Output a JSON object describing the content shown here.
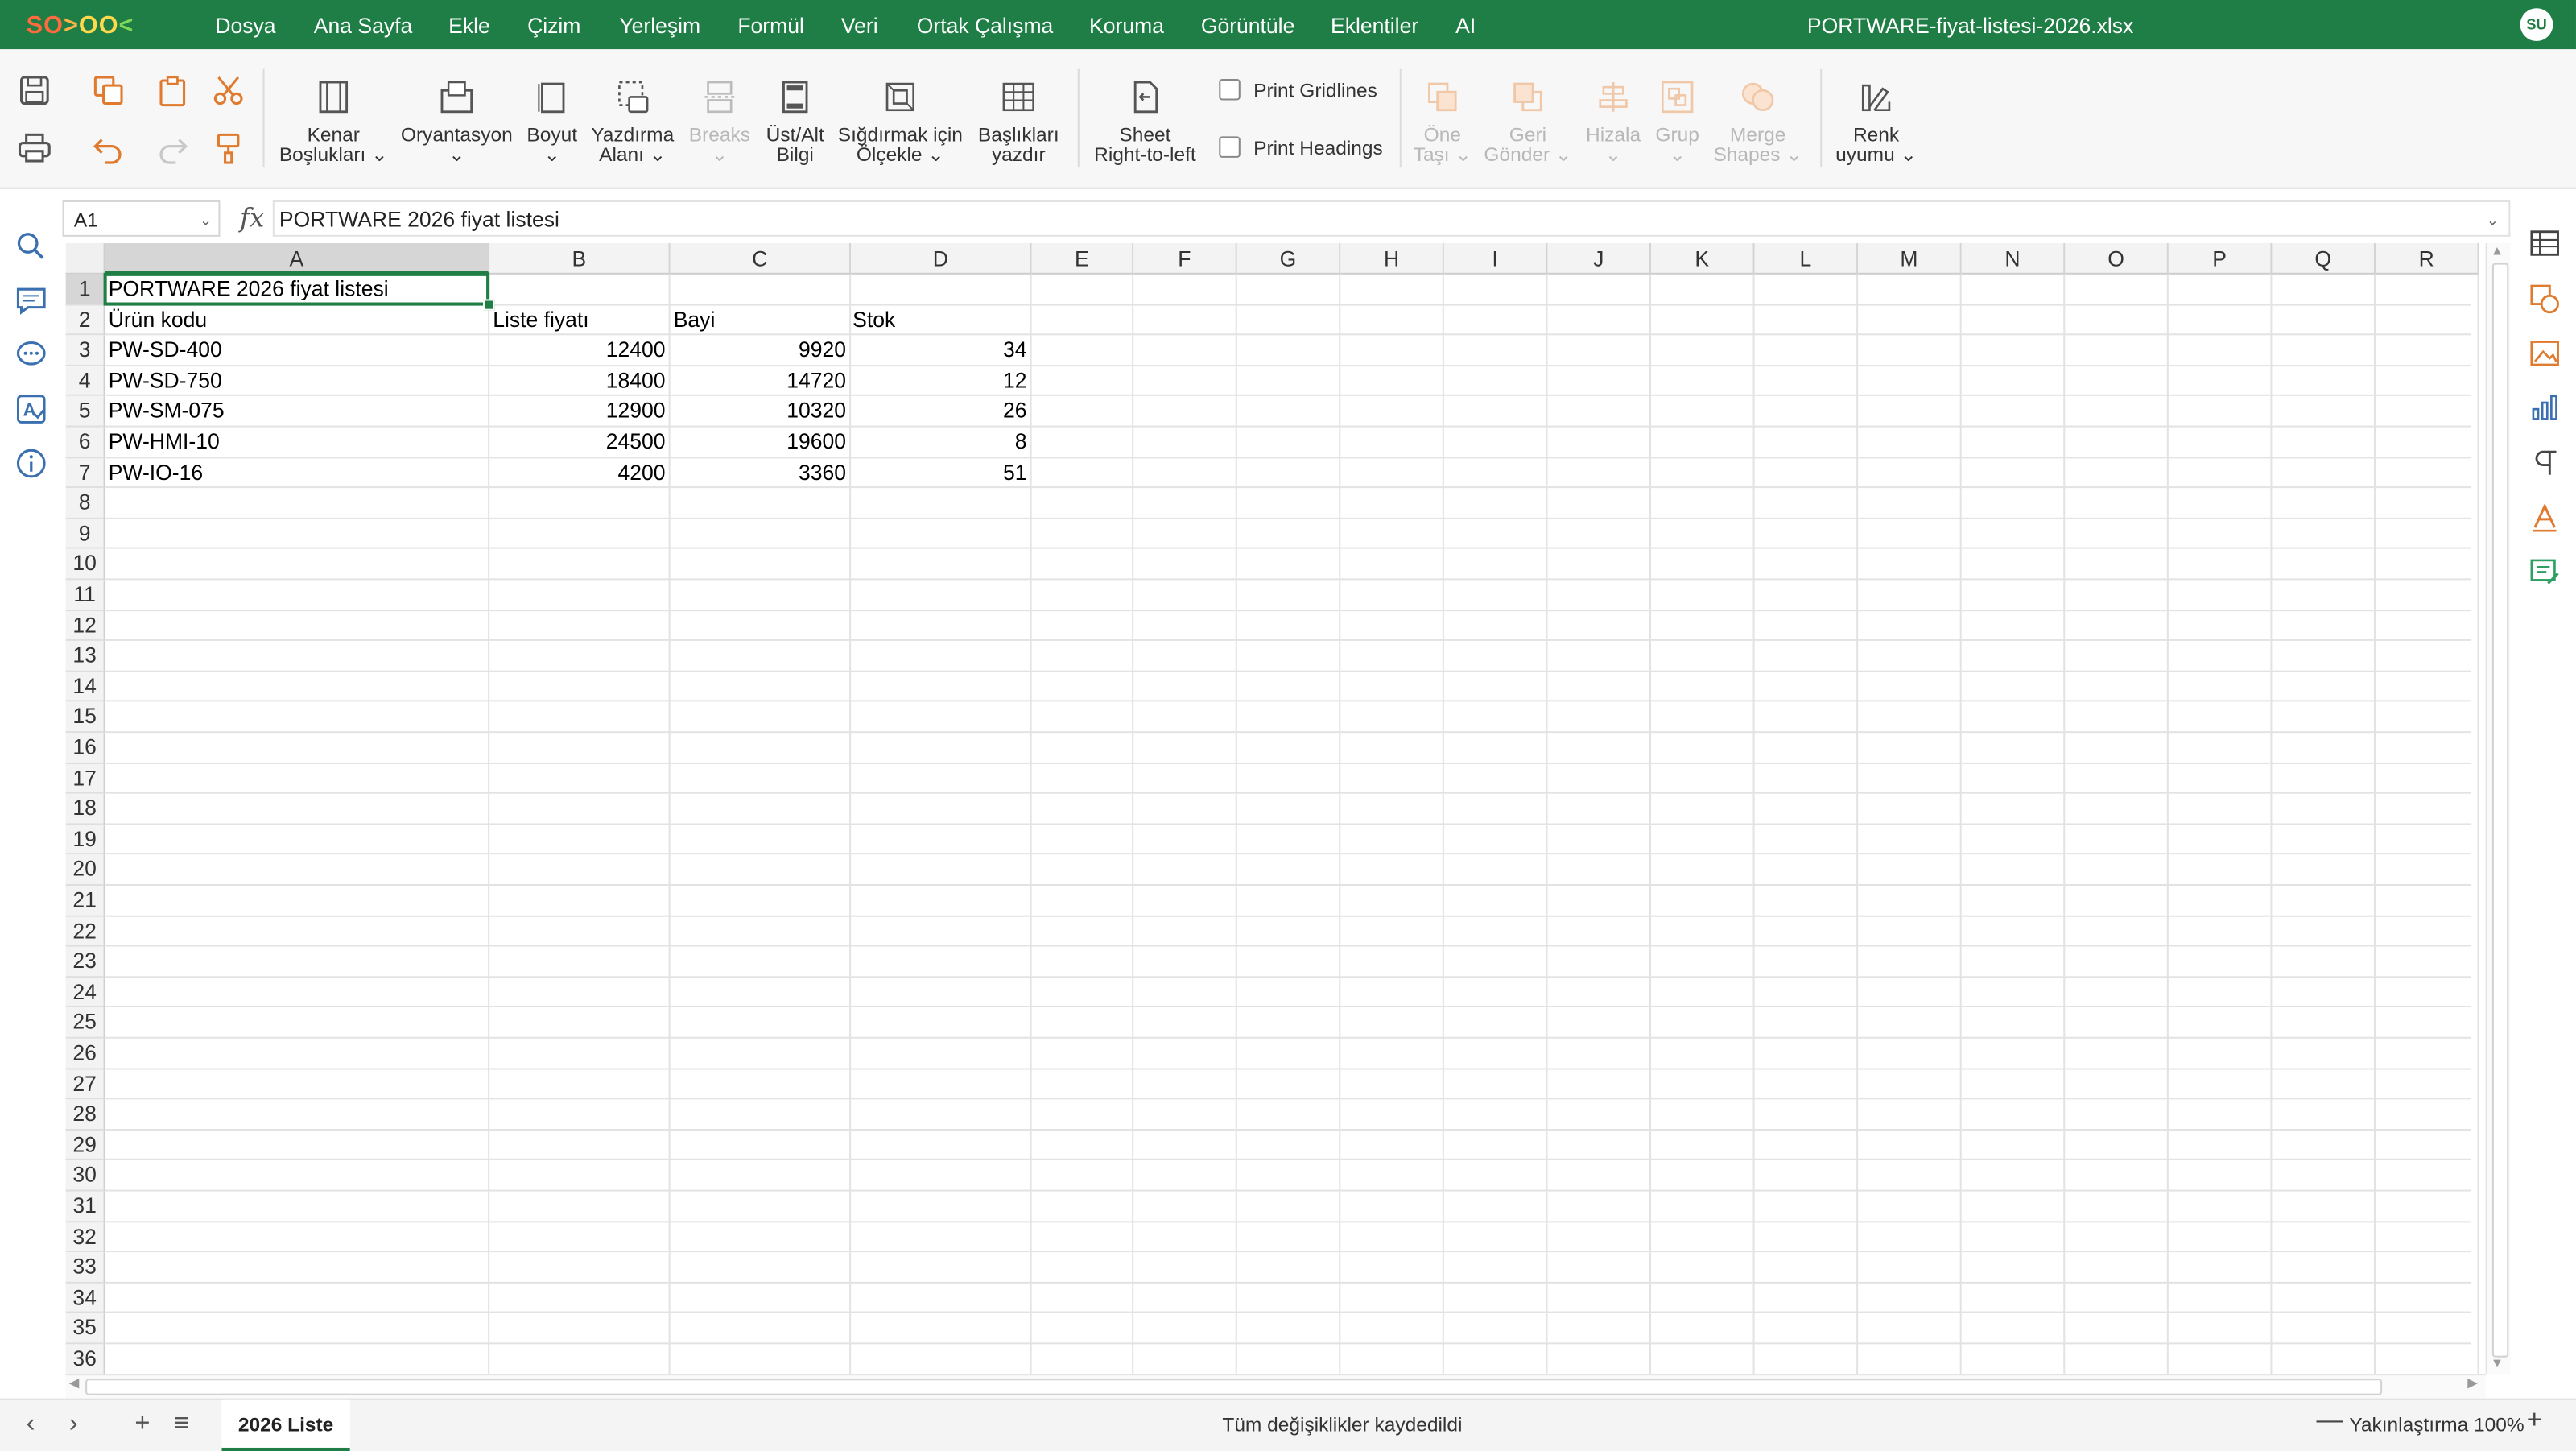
{
  "app": {
    "logo": "SO>OO<",
    "menu": [
      "Dosya",
      "Ana Sayfa",
      "Ekle",
      "Çizim",
      "Yerleşim",
      "Formül",
      "Veri",
      "Ortak Çalışma",
      "Koruma",
      "Görüntüle",
      "Eklentiler",
      "AI"
    ],
    "doc_title": "PORTWARE-fiyat-listesi-2026.xlsx",
    "user_initials": "SU",
    "brand_color": "#1e7e45"
  },
  "ribbon": {
    "kenar": [
      "Kenar",
      "Boşlukları ⌄"
    ],
    "oryantasyon": [
      "Oryantasyon",
      "⌄"
    ],
    "boyut": [
      "Boyut",
      "⌄"
    ],
    "yazdirma": [
      "Yazdırma",
      "Alanı ⌄"
    ],
    "breaks": [
      "Breaks",
      "⌄"
    ],
    "ustalt": [
      "Üst/Alt",
      "Bilgi"
    ],
    "sigdir": [
      "Sığdırmak için",
      "Ölçekle ⌄"
    ],
    "basliklar": [
      "Başlıkları",
      "yazdır"
    ],
    "sheet_rtl": [
      "Sheet",
      "Right-to-left"
    ],
    "print_gridlines": "Print Gridlines",
    "print_headings": "Print Headings",
    "one_tasi": [
      "Öne",
      "Taşı ⌄"
    ],
    "geri_gonder": [
      "Geri",
      "Gönder ⌄"
    ],
    "hizala": [
      "Hizala",
      "⌄"
    ],
    "grup": [
      "Grup",
      "⌄"
    ],
    "merge": [
      "Merge",
      "Shapes ⌄"
    ],
    "renk": [
      "Renk",
      "uyumu ⌄"
    ]
  },
  "formula_bar": {
    "name_box": "A1",
    "fx": "fx",
    "value": "PORTWARE 2026 fiyat listesi"
  },
  "columns": [
    "A",
    "B",
    "C",
    "D",
    "E",
    "F",
    "G",
    "H",
    "I",
    "J",
    "K",
    "L",
    "M",
    "N",
    "O",
    "P",
    "Q",
    "R"
  ],
  "rows": [
    "1",
    "2",
    "3",
    "4",
    "5",
    "6",
    "7",
    "8",
    "9",
    "10",
    "11",
    "12",
    "13",
    "14",
    "15",
    "16",
    "17",
    "18",
    "19",
    "20",
    "21",
    "22",
    "23",
    "24",
    "25",
    "26",
    "27",
    "28",
    "29",
    "30",
    "31",
    "32",
    "33",
    "34",
    "35",
    "36"
  ],
  "sheet": {
    "title": "PORTWARE 2026 fiyat listesi",
    "headers": [
      "Ürün kodu",
      "Liste fiyatı",
      "Bayi",
      "Stok"
    ],
    "rows": [
      [
        "PW-SD-400",
        "12400",
        "9920",
        "34"
      ],
      [
        "PW-SD-750",
        "18400",
        "14720",
        "12"
      ],
      [
        "PW-SM-075",
        "12900",
        "10320",
        "26"
      ],
      [
        "PW-HMI-10",
        "24500",
        "19600",
        "8"
      ],
      [
        "PW-IO-16",
        "4200",
        "3360",
        "51"
      ]
    ]
  },
  "bottom": {
    "sheet_tab": "2026 Liste",
    "status": "Tüm değişiklikler kaydedildi",
    "zoom": "Yakınlaştırma 100%"
  }
}
